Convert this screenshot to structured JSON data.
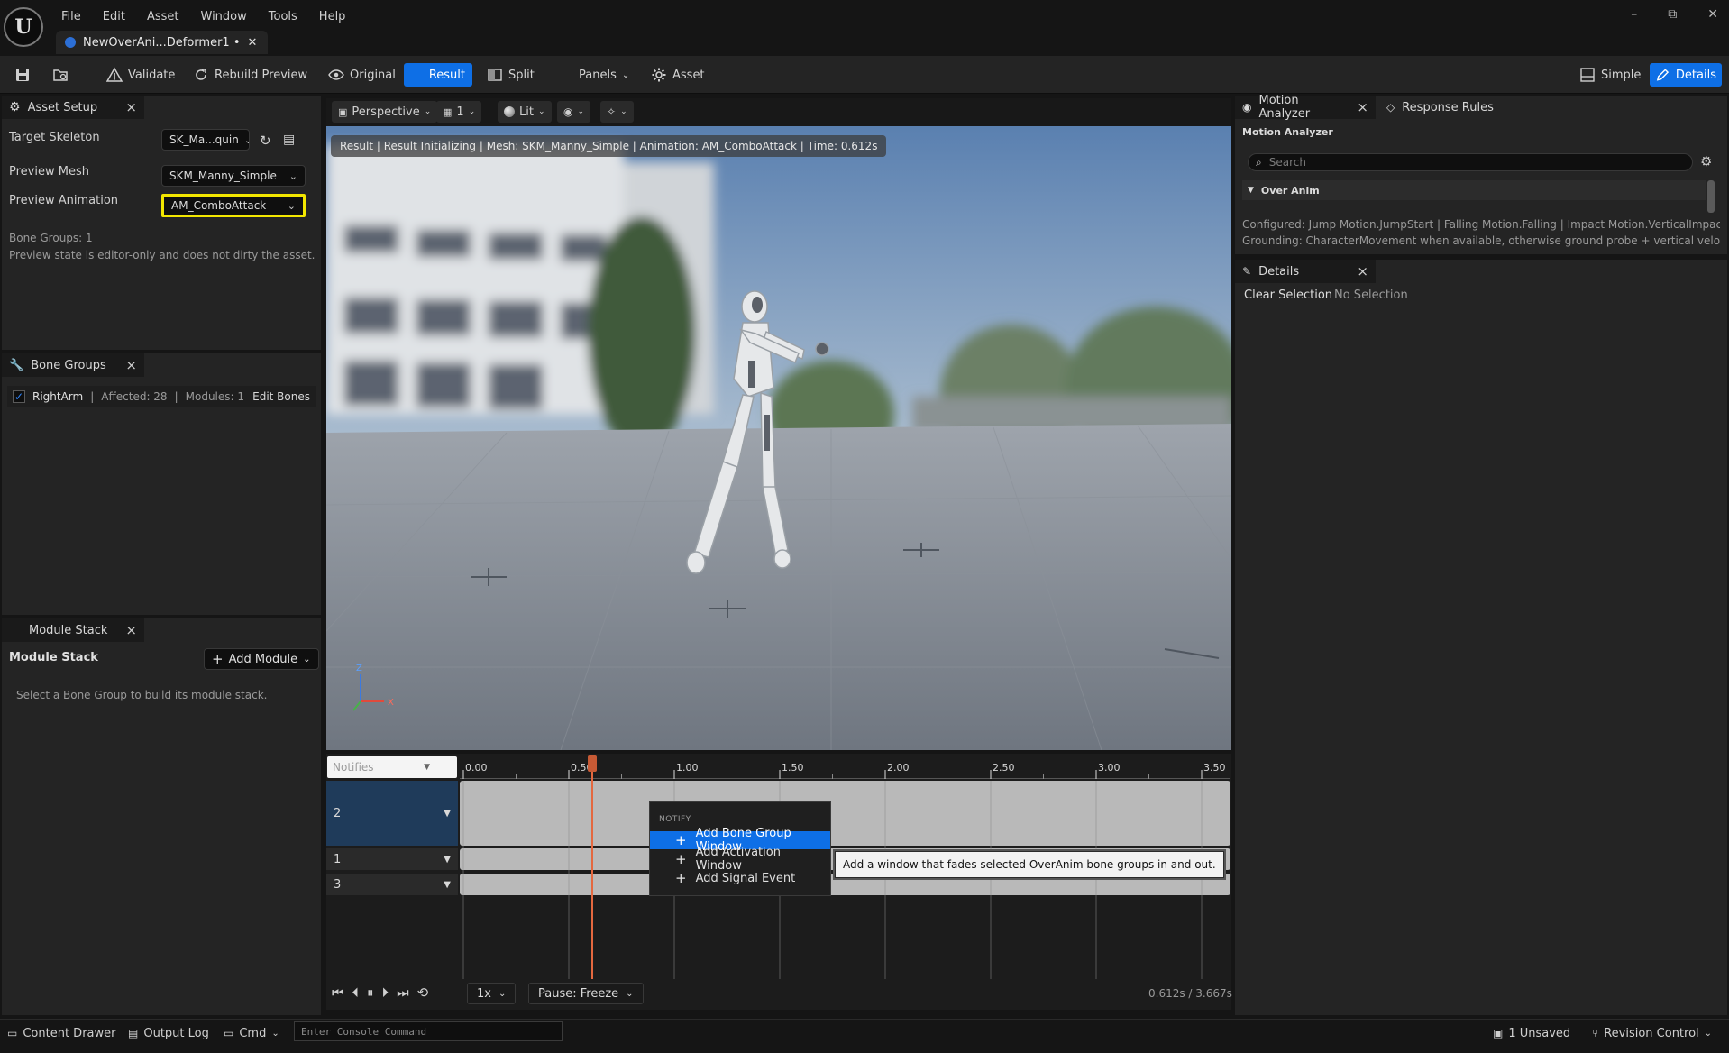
{
  "window": {
    "menu": [
      "File",
      "Edit",
      "Asset",
      "Window",
      "Tools",
      "Help"
    ],
    "doc_tab": "NewOverAni...Deformer1 •",
    "controls": [
      "–",
      "⧉",
      "✕"
    ]
  },
  "toolbar": {
    "validate": "Validate",
    "rebuild": "Rebuild Preview",
    "original": "Original",
    "result": "Result",
    "split": "Split",
    "panels": "Panels",
    "asset": "Asset",
    "simple": "Simple",
    "details": "Details"
  },
  "asset_setup": {
    "tab": "Asset Setup",
    "target_skeleton_label": "Target Skeleton",
    "target_skeleton_value": "SK_Ma...quin",
    "preview_mesh_label": "Preview Mesh",
    "preview_mesh_value": "SKM_Manny_Simple",
    "preview_anim_label": "Preview Animation",
    "preview_anim_value": "AM_ComboAttack",
    "bone_groups_count": "Bone Groups: 1",
    "note": "Preview state is editor-only and does not dirty the asset."
  },
  "bone_groups": {
    "tab": "Bone Groups",
    "item_name": "RightArm",
    "item_affected": "Affected: 28",
    "item_modules": "Modules: 1",
    "edit_bones": "Edit Bones"
  },
  "module_stack": {
    "tab": "Module Stack",
    "header": "Module Stack",
    "add_module": "Add Module",
    "empty": "Select a Bone Group to build its module stack."
  },
  "viewport": {
    "perspective": "Perspective",
    "cam_speed": "1",
    "lit": "Lit",
    "info": "Result | Result Initializing | Mesh: SKM_Manny_Simple | Animation: AM_ComboAttack | Time: 0.612s",
    "axis_z": "Z",
    "axis_x": "X"
  },
  "timeline": {
    "notifies_placeholder": "Notifies",
    "ruler": [
      "0.00",
      "0.50",
      "1.00",
      "1.50",
      "2.00",
      "2.50",
      "3.00",
      "3.50"
    ],
    "tracks": [
      "2",
      "1",
      "3"
    ],
    "speed": "1x",
    "pause_mode": "Pause: Freeze",
    "time_readout": "0.612s / 3.667s",
    "playhead_seconds": 0.612,
    "duration_seconds": 3.667
  },
  "context_menu": {
    "section": "NOTIFY",
    "items": [
      "Add Bone Group Window",
      "Add Activation Window",
      "Add Signal Event"
    ],
    "tooltip": "Add a window that fades selected OverAnim bone groups in and out."
  },
  "motion_analyzer": {
    "tab": "Motion Analyzer",
    "tab2": "Response Rules",
    "title": "Motion Analyzer",
    "search_placeholder": "Search",
    "category": "Over Anim",
    "configured": "Configured: Jump Motion.JumpStart | Falling Motion.Falling | Impact Motion.VerticalImpact | S",
    "grounding": "Grounding: CharacterMovement when available, otherwise ground probe + vertical velocity th"
  },
  "details": {
    "tab": "Details",
    "clear_selection": "Clear Selection",
    "no_selection": "No Selection"
  },
  "statusbar": {
    "content_drawer": "Content Drawer",
    "output_log": "Output Log",
    "cmd": "Cmd",
    "console_placeholder": "Enter Console Command",
    "unsaved": "1 Unsaved",
    "revision": "Revision Control"
  },
  "colors": {
    "accent": "#0e6fe6",
    "highlight_border": "#f2e600",
    "playhead": "#e4683f"
  }
}
